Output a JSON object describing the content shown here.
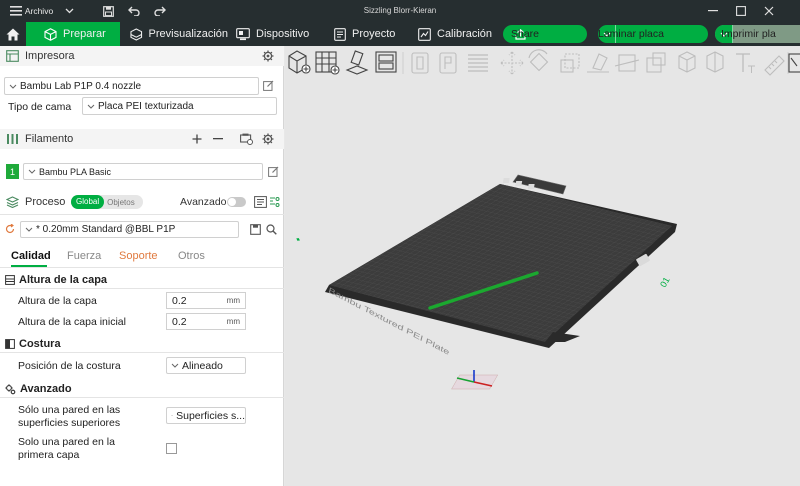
{
  "window": {
    "menu_label": "Archivo",
    "title": "Sizzling Blorr-Kieran"
  },
  "tabs": {
    "prepare": "Preparar",
    "preview": "Previsualización",
    "device": "Dispositivo",
    "project": "Proyecto",
    "calibration": "Calibración"
  },
  "actions": {
    "share": "Share",
    "slice": "Laminar placa",
    "print": "Imprimir pla"
  },
  "printer": {
    "section_title": "Impresora",
    "selected": "Bambu Lab P1P 0.4 nozzle",
    "bed_label": "Tipo de cama",
    "bed_value": "Placa PEI texturizada"
  },
  "filament": {
    "section_title": "Filamento",
    "slot_number": "1",
    "selected": "Bambu PLA Basic",
    "color": "#1faa3a"
  },
  "process": {
    "section_title": "Proceso",
    "toggle_global": "Global",
    "toggle_objects": "Objetos",
    "advanced_label": "Avanzado",
    "preset": "* 0.20mm Standard @BBL P1P",
    "tabs": [
      "Calidad",
      "Fuerza",
      "Soporte",
      "Otros"
    ],
    "groups": {
      "layer_height": {
        "title": "Altura de la capa",
        "layer_height_label": "Altura de la capa",
        "layer_height_value": "0.2",
        "initial_layer_label": "Altura de la capa inicial",
        "initial_layer_value": "0.2",
        "unit": "mm"
      },
      "seam": {
        "title": "Costura",
        "position_label": "Posición de la costura",
        "position_value": "Alineado"
      },
      "advanced": {
        "title": "Avanzado",
        "single_wall_top_label_1": "Sólo una pared en las",
        "single_wall_top_label_2": "superficies superiores",
        "single_wall_top_value": "Superficies s...",
        "single_wall_first_label_1": "Solo una pared en la",
        "single_wall_first_label_2": "primera capa"
      }
    }
  },
  "plate": {
    "label": "Bambu Textured PEI Plate",
    "plate_number": "01"
  },
  "colors": {
    "accent": "#00ae42",
    "topbar": "#262e30",
    "soporte_tab": "#e07a3f"
  }
}
